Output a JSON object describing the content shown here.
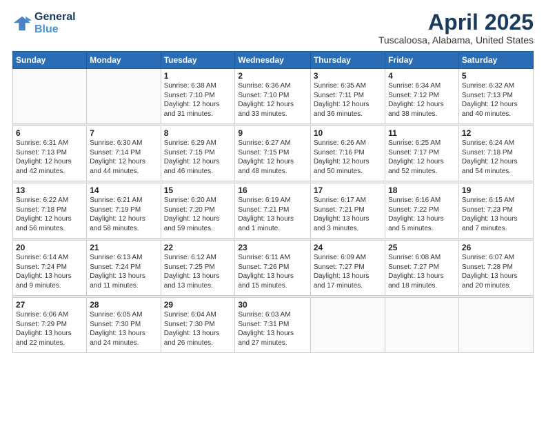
{
  "logo": {
    "line1": "General",
    "line2": "Blue"
  },
  "title": "April 2025",
  "location": "Tuscaloosa, Alabama, United States",
  "weekdays": [
    "Sunday",
    "Monday",
    "Tuesday",
    "Wednesday",
    "Thursday",
    "Friday",
    "Saturday"
  ],
  "weeks": [
    [
      {
        "day": "",
        "info": ""
      },
      {
        "day": "",
        "info": ""
      },
      {
        "day": "1",
        "info": "Sunrise: 6:38 AM\nSunset: 7:10 PM\nDaylight: 12 hours\nand 31 minutes."
      },
      {
        "day": "2",
        "info": "Sunrise: 6:36 AM\nSunset: 7:10 PM\nDaylight: 12 hours\nand 33 minutes."
      },
      {
        "day": "3",
        "info": "Sunrise: 6:35 AM\nSunset: 7:11 PM\nDaylight: 12 hours\nand 36 minutes."
      },
      {
        "day": "4",
        "info": "Sunrise: 6:34 AM\nSunset: 7:12 PM\nDaylight: 12 hours\nand 38 minutes."
      },
      {
        "day": "5",
        "info": "Sunrise: 6:32 AM\nSunset: 7:13 PM\nDaylight: 12 hours\nand 40 minutes."
      }
    ],
    [
      {
        "day": "6",
        "info": "Sunrise: 6:31 AM\nSunset: 7:13 PM\nDaylight: 12 hours\nand 42 minutes."
      },
      {
        "day": "7",
        "info": "Sunrise: 6:30 AM\nSunset: 7:14 PM\nDaylight: 12 hours\nand 44 minutes."
      },
      {
        "day": "8",
        "info": "Sunrise: 6:29 AM\nSunset: 7:15 PM\nDaylight: 12 hours\nand 46 minutes."
      },
      {
        "day": "9",
        "info": "Sunrise: 6:27 AM\nSunset: 7:15 PM\nDaylight: 12 hours\nand 48 minutes."
      },
      {
        "day": "10",
        "info": "Sunrise: 6:26 AM\nSunset: 7:16 PM\nDaylight: 12 hours\nand 50 minutes."
      },
      {
        "day": "11",
        "info": "Sunrise: 6:25 AM\nSunset: 7:17 PM\nDaylight: 12 hours\nand 52 minutes."
      },
      {
        "day": "12",
        "info": "Sunrise: 6:24 AM\nSunset: 7:18 PM\nDaylight: 12 hours\nand 54 minutes."
      }
    ],
    [
      {
        "day": "13",
        "info": "Sunrise: 6:22 AM\nSunset: 7:18 PM\nDaylight: 12 hours\nand 56 minutes."
      },
      {
        "day": "14",
        "info": "Sunrise: 6:21 AM\nSunset: 7:19 PM\nDaylight: 12 hours\nand 58 minutes."
      },
      {
        "day": "15",
        "info": "Sunrise: 6:20 AM\nSunset: 7:20 PM\nDaylight: 12 hours\nand 59 minutes."
      },
      {
        "day": "16",
        "info": "Sunrise: 6:19 AM\nSunset: 7:21 PM\nDaylight: 13 hours\nand 1 minute."
      },
      {
        "day": "17",
        "info": "Sunrise: 6:17 AM\nSunset: 7:21 PM\nDaylight: 13 hours\nand 3 minutes."
      },
      {
        "day": "18",
        "info": "Sunrise: 6:16 AM\nSunset: 7:22 PM\nDaylight: 13 hours\nand 5 minutes."
      },
      {
        "day": "19",
        "info": "Sunrise: 6:15 AM\nSunset: 7:23 PM\nDaylight: 13 hours\nand 7 minutes."
      }
    ],
    [
      {
        "day": "20",
        "info": "Sunrise: 6:14 AM\nSunset: 7:24 PM\nDaylight: 13 hours\nand 9 minutes."
      },
      {
        "day": "21",
        "info": "Sunrise: 6:13 AM\nSunset: 7:24 PM\nDaylight: 13 hours\nand 11 minutes."
      },
      {
        "day": "22",
        "info": "Sunrise: 6:12 AM\nSunset: 7:25 PM\nDaylight: 13 hours\nand 13 minutes."
      },
      {
        "day": "23",
        "info": "Sunrise: 6:11 AM\nSunset: 7:26 PM\nDaylight: 13 hours\nand 15 minutes."
      },
      {
        "day": "24",
        "info": "Sunrise: 6:09 AM\nSunset: 7:27 PM\nDaylight: 13 hours\nand 17 minutes."
      },
      {
        "day": "25",
        "info": "Sunrise: 6:08 AM\nSunset: 7:27 PM\nDaylight: 13 hours\nand 18 minutes."
      },
      {
        "day": "26",
        "info": "Sunrise: 6:07 AM\nSunset: 7:28 PM\nDaylight: 13 hours\nand 20 minutes."
      }
    ],
    [
      {
        "day": "27",
        "info": "Sunrise: 6:06 AM\nSunset: 7:29 PM\nDaylight: 13 hours\nand 22 minutes."
      },
      {
        "day": "28",
        "info": "Sunrise: 6:05 AM\nSunset: 7:30 PM\nDaylight: 13 hours\nand 24 minutes."
      },
      {
        "day": "29",
        "info": "Sunrise: 6:04 AM\nSunset: 7:30 PM\nDaylight: 13 hours\nand 26 minutes."
      },
      {
        "day": "30",
        "info": "Sunrise: 6:03 AM\nSunset: 7:31 PM\nDaylight: 13 hours\nand 27 minutes."
      },
      {
        "day": "",
        "info": ""
      },
      {
        "day": "",
        "info": ""
      },
      {
        "day": "",
        "info": ""
      }
    ]
  ]
}
